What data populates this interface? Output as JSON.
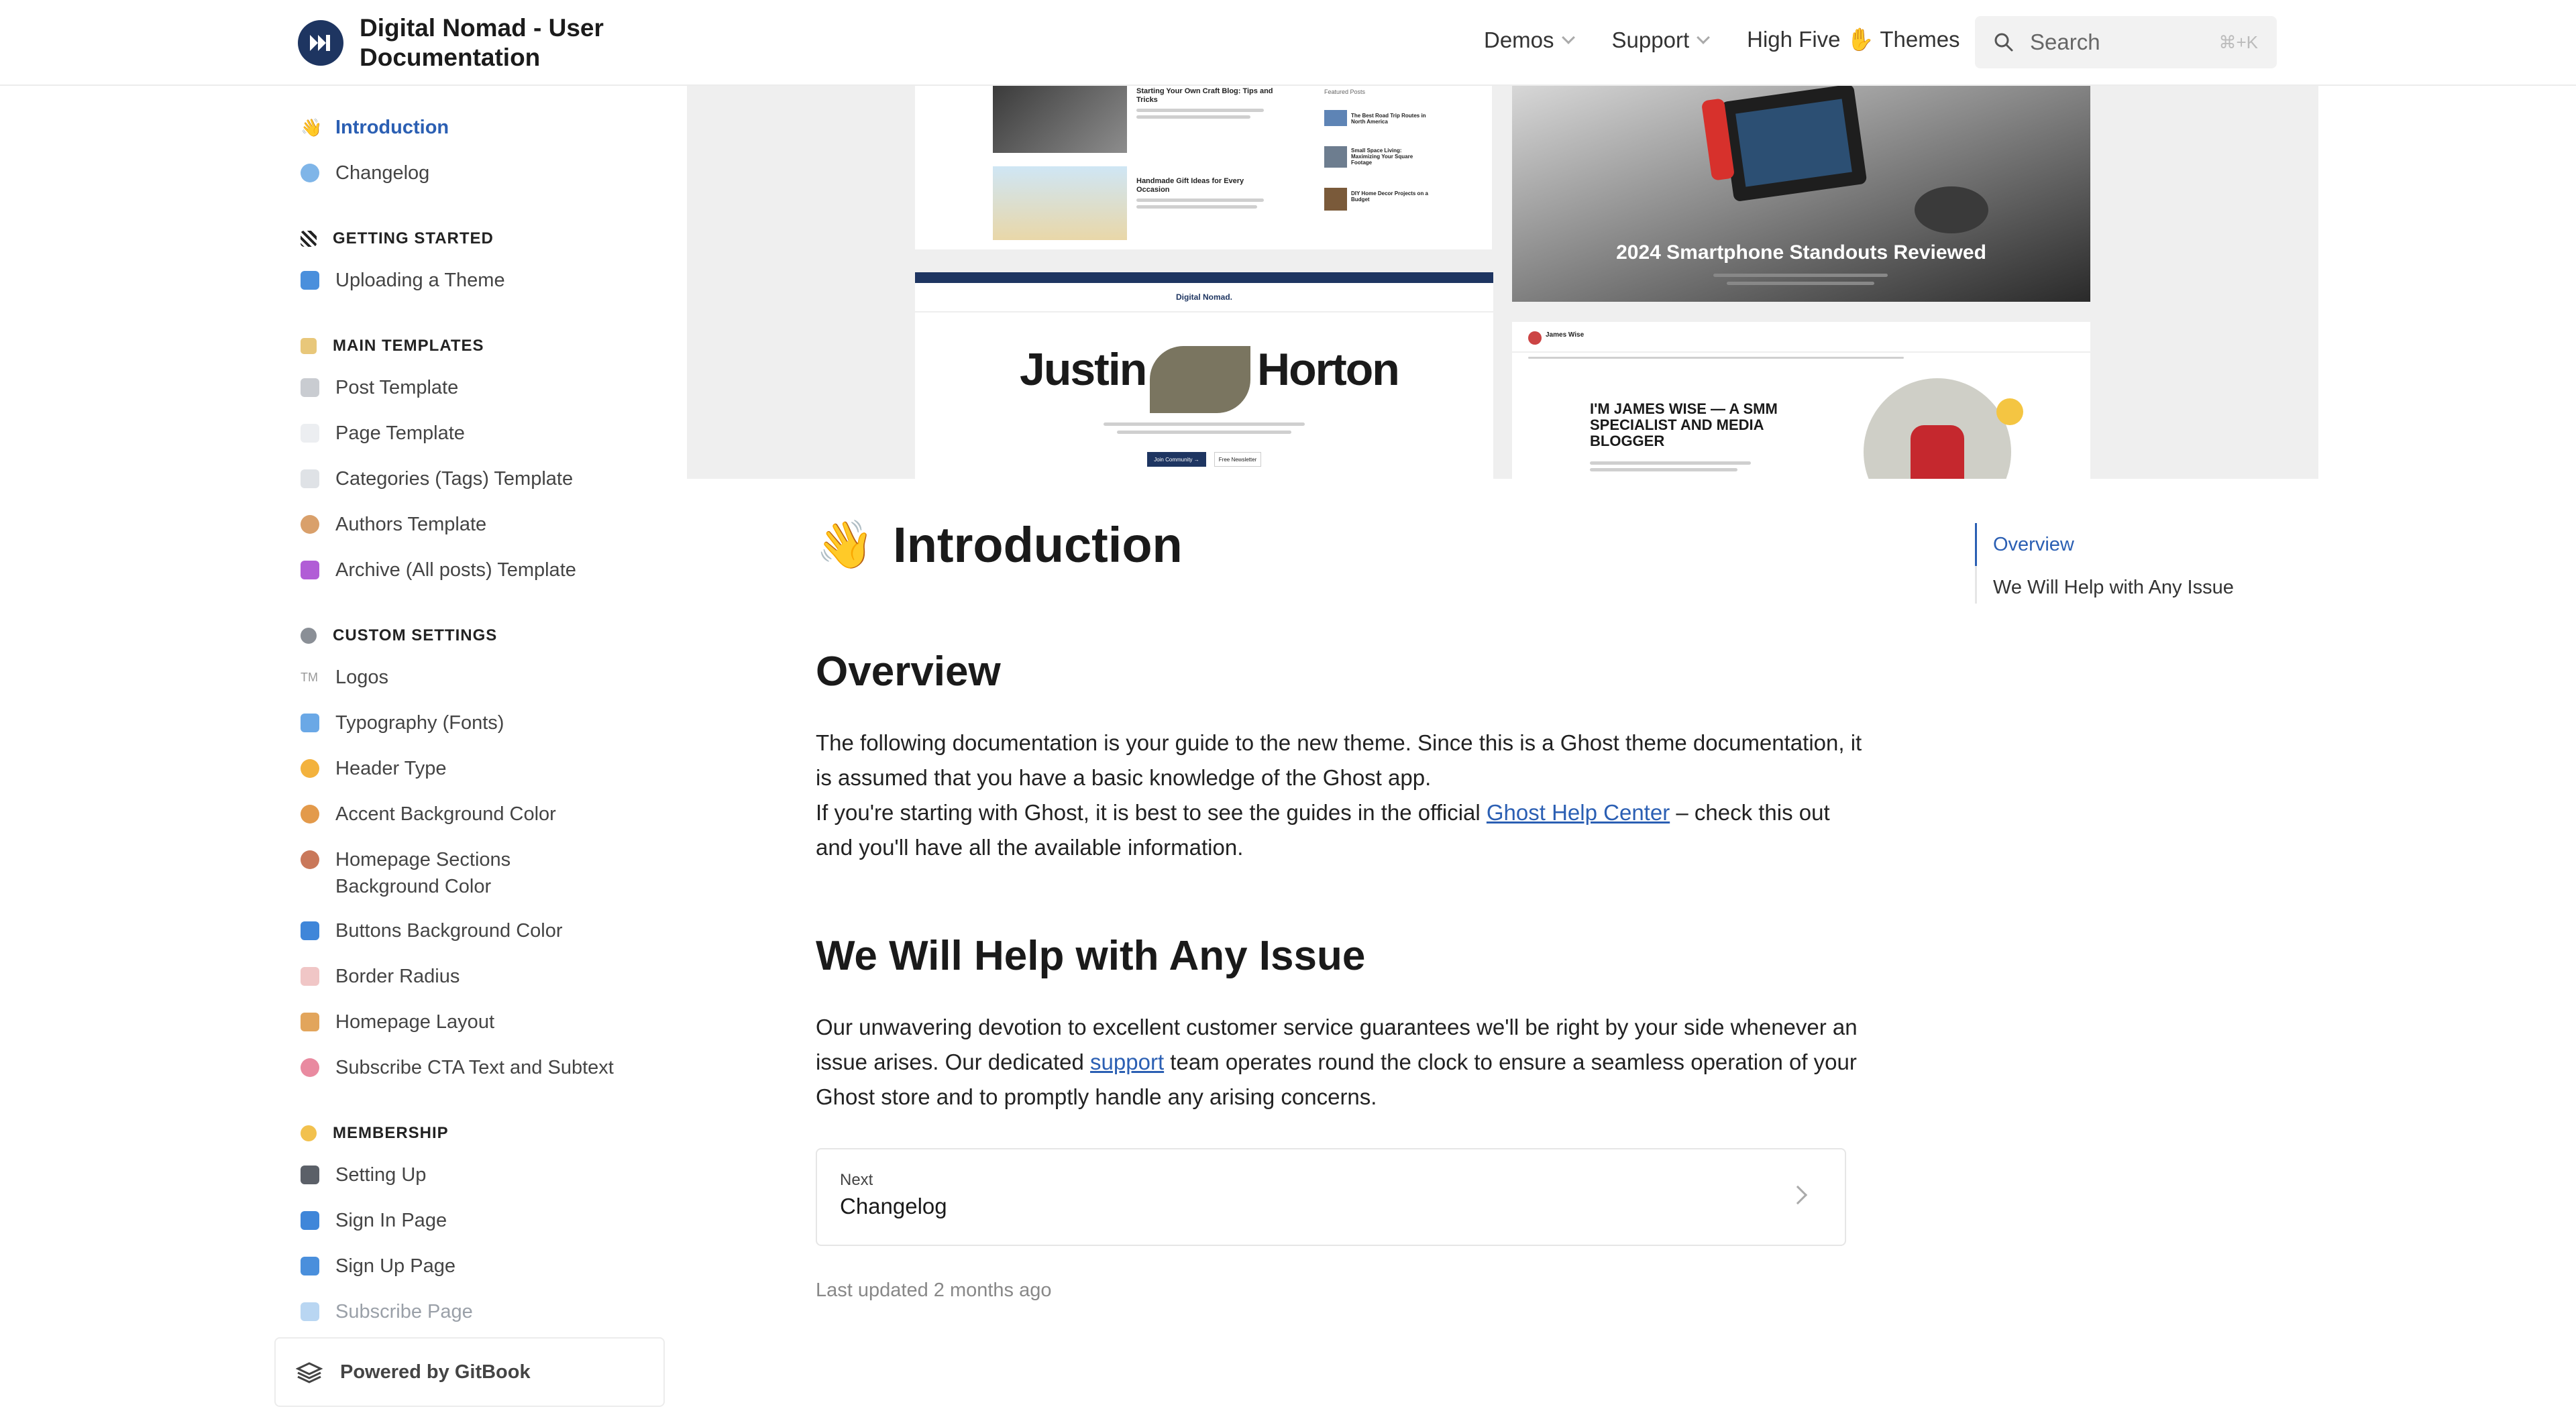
{
  "header": {
    "title": "Digital Nomad - User Documentation",
    "nav": [
      {
        "label": "Demos"
      },
      {
        "label": "Support"
      },
      {
        "label": "High Five ✋ Themes"
      }
    ],
    "search": {
      "placeholder": "Search",
      "shortcut": "⌘+K"
    }
  },
  "sidebar": {
    "top": [
      {
        "label": "Introduction",
        "emoji": "👋"
      },
      {
        "label": "Changelog"
      }
    ],
    "groups": [
      {
        "title": "GETTING STARTED",
        "items": [
          {
            "label": "Uploading a Theme"
          }
        ]
      },
      {
        "title": "MAIN TEMPLATES",
        "items": [
          {
            "label": "Post Template"
          },
          {
            "label": "Page Template"
          },
          {
            "label": "Categories (Tags) Template"
          },
          {
            "label": "Authors Template"
          },
          {
            "label": "Archive (All posts) Template"
          }
        ]
      },
      {
        "title": "CUSTOM SETTINGS",
        "items": [
          {
            "label": "Logos",
            "icon_text": "TM"
          },
          {
            "label": "Typography (Fonts)"
          },
          {
            "label": "Header Type"
          },
          {
            "label": "Accent Background Color"
          },
          {
            "label": "Homepage Sections Background Color"
          },
          {
            "label": "Buttons Background Color"
          },
          {
            "label": "Border Radius"
          },
          {
            "label": "Homepage Layout"
          },
          {
            "label": "Subscribe CTA Text and Subtext"
          }
        ]
      },
      {
        "title": "MEMBERSHIP",
        "items": [
          {
            "label": "Setting Up"
          },
          {
            "label": "Sign In Page"
          },
          {
            "label": "Sign Up Page"
          },
          {
            "label": "Subscribe Page"
          }
        ]
      }
    ],
    "footer": {
      "label": "Powered by GitBook"
    }
  },
  "hero": {
    "card1": {
      "post1": "Starting Your Own Craft Blog: Tips and Tricks",
      "post2": "Handmade Gift Ideas for Every Occasion",
      "featured_label": "Featured Posts",
      "featured": [
        "The Best Road Trip Routes in North America",
        "Small Space Living: Maximizing Your Square Footage",
        "DIY Home Decor Projects on a Budget"
      ]
    },
    "card2": {
      "headline": "2024 Smartphone Standouts Reviewed"
    },
    "card3": {
      "brand": "Digital Nomad.",
      "name_first": "Justin",
      "name_last": "Horton",
      "button1": "Join Community →",
      "button2": "Free Newsletter"
    },
    "card4": {
      "author": "James Wise",
      "headline": "I'M JAMES WISE — A SMM SPECIALIST AND MEDIA BLOGGER"
    }
  },
  "content": {
    "title": "Introduction",
    "title_emoji": "👋",
    "overview": {
      "heading": "Overview",
      "p1": "The following documentation is your guide to the new theme. Since this is a Ghost theme documentation, it is assumed that you have a basic knowledge of the Ghost app.",
      "p2_before": "If you're starting with Ghost, it is best to see the guides in the official ",
      "p2_link": "Ghost Help Center",
      "p2_after": " – check this out and you'll have all the available information."
    },
    "help": {
      "heading": "We Will Help with Any Issue",
      "p_before": "Our unwavering devotion to excellent customer service guarantees we'll be right by your side whenever an issue arises. Our dedicated ",
      "p_link": "support",
      "p_after": " team operates round the clock to ensure a seamless operation of your Ghost store and to promptly handle any arising concerns."
    },
    "next": {
      "label": "Next",
      "title": "Changelog"
    },
    "last_updated": "Last updated 2 months ago"
  },
  "toc": [
    {
      "label": "Overview"
    },
    {
      "label": "We Will Help with Any Issue"
    }
  ],
  "colors": {
    "accent": "#2b5fb3",
    "brand_dark": "#1e3561"
  }
}
